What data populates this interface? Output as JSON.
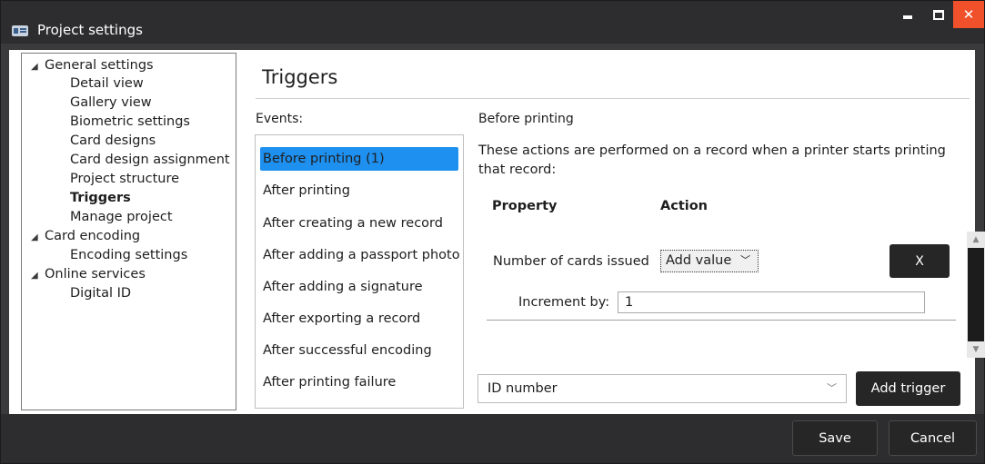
{
  "window": {
    "title": "Project settings",
    "close_glyph": "✕"
  },
  "tree": {
    "groups": [
      {
        "label": "General settings",
        "children": [
          "Detail view",
          "Gallery view",
          "Biometric settings",
          "Card designs",
          "Card design assignment",
          "Project structure",
          "Triggers",
          "Manage project"
        ]
      },
      {
        "label": "Card encoding",
        "children": [
          "Encoding settings"
        ]
      },
      {
        "label": "Online services",
        "children": [
          "Digital ID"
        ]
      }
    ],
    "active": "Triggers"
  },
  "page": {
    "title": "Triggers",
    "events_label": "Events:",
    "events": [
      "Before printing (1)",
      "After printing",
      "After creating a new record",
      "After adding a passport photo",
      "After adding a signature",
      "After exporting a record",
      "After successful encoding",
      "After printing failure"
    ],
    "selected_event": "Before printing (1)",
    "section_title": "Before printing",
    "section_desc": "These actions are performed on a record when a printer starts printing that record:",
    "property_header": "Property",
    "action_header": "Action",
    "row": {
      "property": "Number of cards issued",
      "action_value": "Add value",
      "remove_label": "X",
      "increment_label": "Increment by:",
      "increment_value": "1"
    },
    "field_select_value": "ID number",
    "add_trigger_label": "Add trigger"
  },
  "footer": {
    "save_label": "Save",
    "cancel_label": "Cancel"
  },
  "colors": {
    "accent_selected": "#1e90f0",
    "close_button": "#f0502a",
    "chrome": "#2d2d30"
  }
}
